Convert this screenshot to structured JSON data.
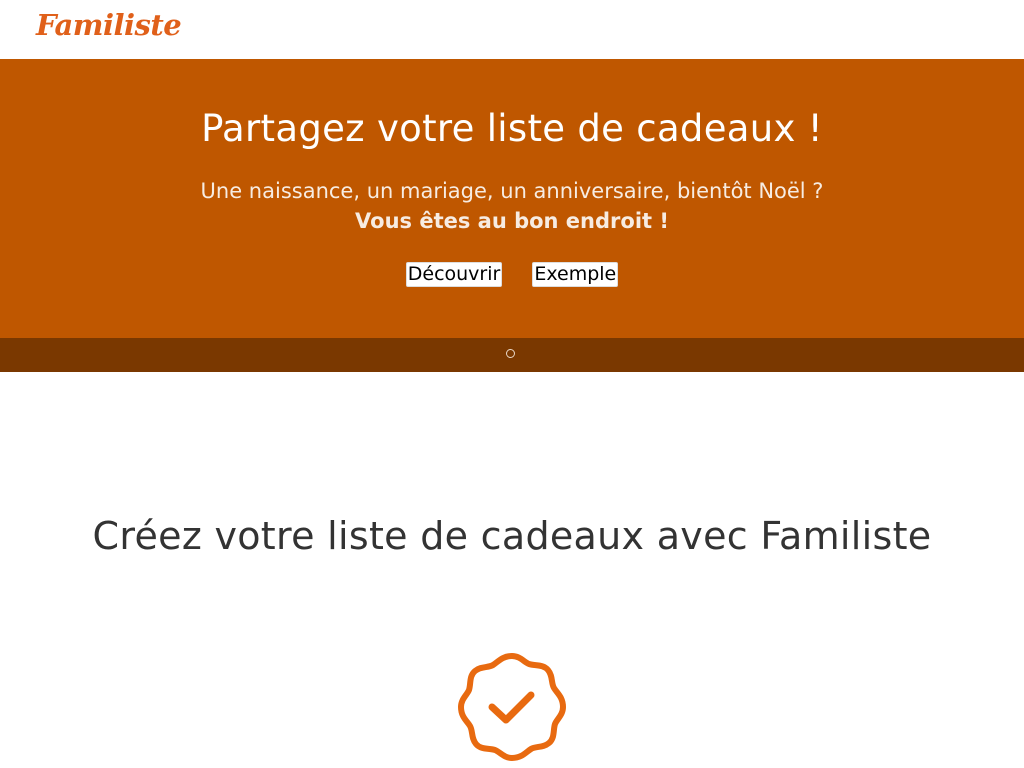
{
  "header": {
    "logo_text": "Familiste"
  },
  "hero": {
    "title": "Partagez votre liste de cadeaux !",
    "subtitle": "Une naissance, un mariage, un anniversaire, bientôt Noël ?",
    "subtitle_bold": "Vous êtes au bon endroit !",
    "buttons": [
      {
        "label": "Découvrir"
      },
      {
        "label": "Exemple"
      }
    ]
  },
  "carousel": {
    "active_index": 0,
    "count": 1
  },
  "main": {
    "section_title": "Créez votre liste de cadeaux avec Familiste",
    "badge_icon": "verified-badge-icon"
  },
  "colors": {
    "brand": "#e0601a",
    "hero_bg": "#bf5700",
    "dots_bar_bg": "#7a3800",
    "badge_orange": "#e86a10"
  }
}
